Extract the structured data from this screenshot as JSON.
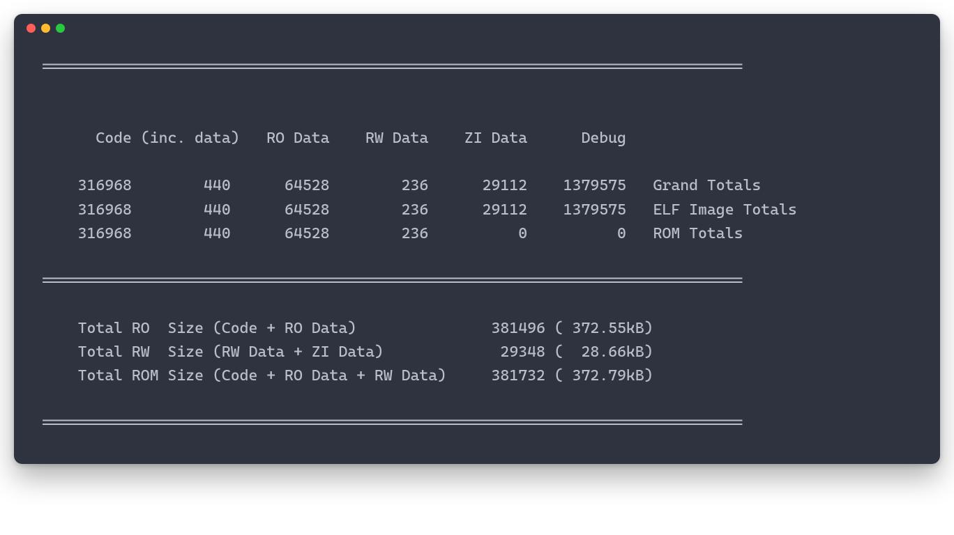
{
  "separator": "==============================================================================",
  "blank": "",
  "header": "      Code (inc. data)   RO Data    RW Data    ZI Data      Debug   ",
  "rows": [
    "    316968        440      64528        236      29112    1379575   Grand Totals",
    "    316968        440      64528        236      29112    1379575   ELF Image Totals",
    "    316968        440      64528        236          0          0   ROM Totals"
  ],
  "summary": [
    "    Total RO  Size (Code + RO Data)               381496 ( 372.55kB)",
    "    Total RW  Size (RW Data + ZI Data)             29348 (  28.66kB)",
    "    Total ROM Size (Code + RO Data + RW Data)     381732 ( 372.79kB)"
  ]
}
